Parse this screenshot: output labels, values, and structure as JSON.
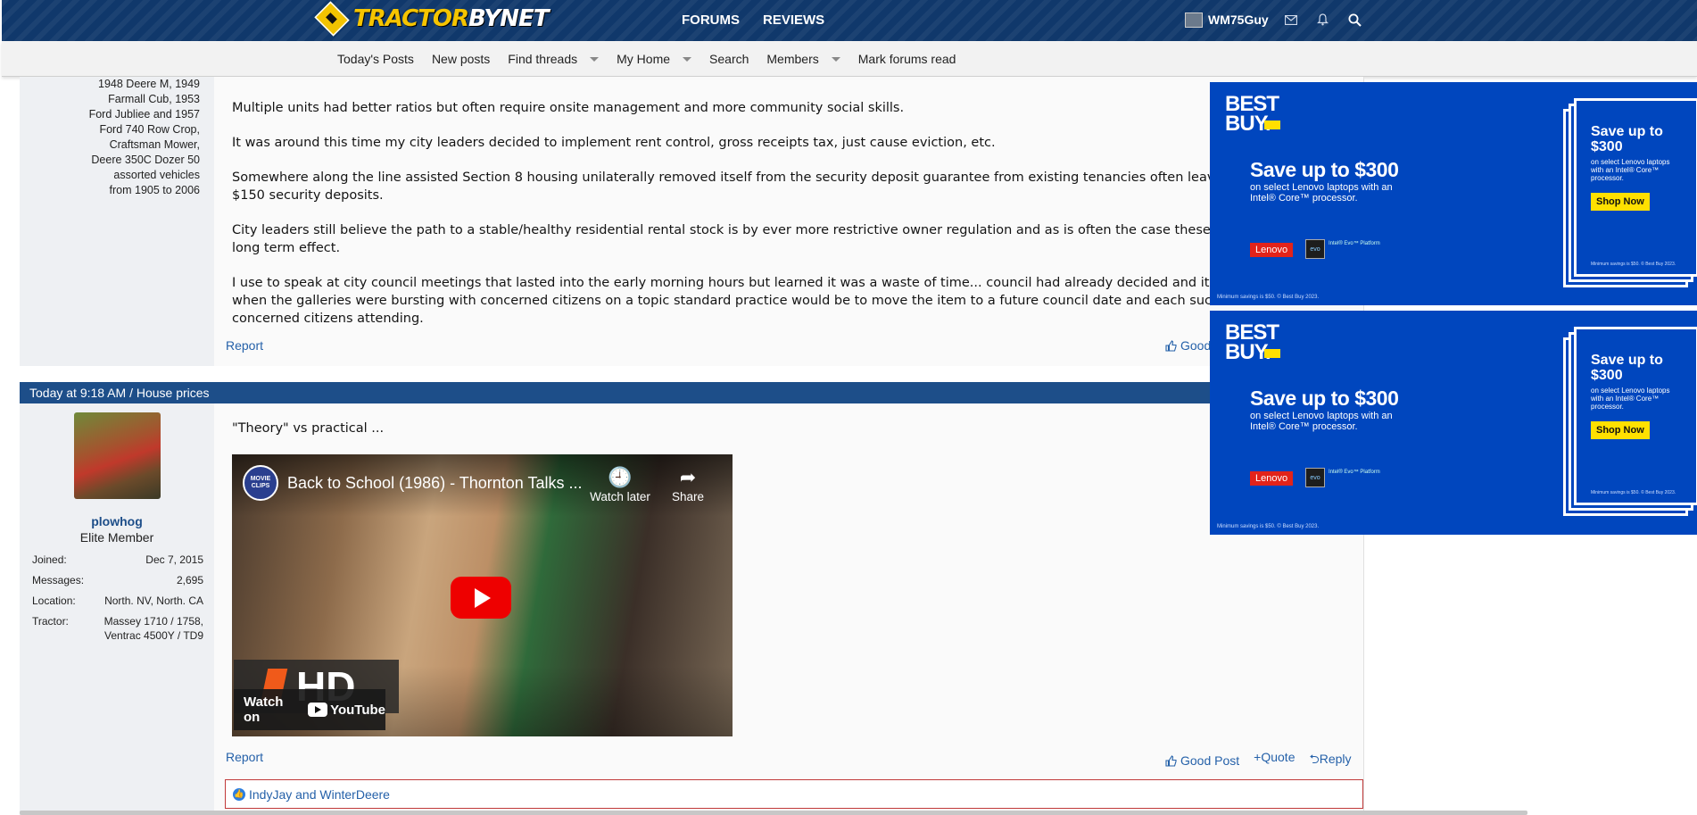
{
  "header": {
    "logo_text_a": "TRACTOR",
    "logo_text_b": "BYNET",
    "nav": [
      "FORUMS",
      "REVIEWS"
    ],
    "username": "WM75Guy"
  },
  "subnav": {
    "items": [
      "Today's Posts",
      "New posts",
      "Find threads",
      "My Home",
      "Search",
      "Members",
      "Mark forums read"
    ]
  },
  "post1": {
    "tractor_lines": [
      "1948 Deere M, 1949",
      "Farmall Cub, 1953",
      "Ford Jubliee and 1957",
      "Ford 740 Row Crop,",
      "Craftsman Mower,",
      "Deere 350C Dozer 50",
      "assorted vehicles",
      "from 1905 to 2006"
    ],
    "paragraphs": [
      "Multiple units had better ratios but often require onsite management and more community social skills.",
      "It was around this time my city leaders decided to implement rent control, gross receipts tax, just cause eviction, etc.",
      "Somewhere along the line assisted Section 8 housing unilaterally removed itself from the security deposit guarantee from existing tenancies often leaving c",
      "$150 security deposits.",
      "City leaders still believe the path to a stable/healthy residential rental stock is by ever more restrictive owner regulation and as is often the case these acti",
      "long term effect.",
      "I use to speak at city council meetings that lasted into the early morning hours but learned it was a waste of time... council had already decided and it was",
      "when the galleries were bursting with concerned citizens on a topic standard practice would be to move the item to a future council date and each such act",
      "concerned citizens attending."
    ],
    "report": "Report",
    "good_post": "Good"
  },
  "post2": {
    "header": "Today at 9:18 AM / House prices",
    "username": "plowhog",
    "title": "Elite Member",
    "stats": [
      {
        "label": "Joined:",
        "value": "Dec 7, 2015"
      },
      {
        "label": "Messages:",
        "value": "2,695"
      },
      {
        "label": "Location:",
        "value": "North. NV, North. CA"
      },
      {
        "label": "Tractor:",
        "value": "Massey 1710 / 1758,"
      },
      {
        "label": "",
        "value": "Ventrac 4500Y / TD9"
      }
    ],
    "body": "\"Theory\" vs practical ...",
    "video": {
      "channel": "MOVIE CLIPS",
      "title": "Back to School (1986) - Thornton Talks ...",
      "watch_later": "Watch later",
      "share": "Share",
      "hd": "HD",
      "watch_on": "Watch on",
      "youtube": "YouTube"
    },
    "report": "Report",
    "actions": [
      "Good Post",
      "Quote",
      "Reply"
    ],
    "reactions": "IndyJay and WinterDeere"
  },
  "ad": {
    "brand_a": "BEST",
    "brand_b": "BUY.",
    "headline": "Save up to $300",
    "sub": "on select Lenovo laptops with an Intel® Core™ processor.",
    "lenovo": "Lenovo",
    "evo": "evo",
    "intel_text": "Intel® Evo™ Platform",
    "minimum": "Minimum savings is $50. © Best Buy 2023.",
    "card_head": "Save up to $300",
    "card_sub": "on select Lenovo laptops with an Intel® Core™ processor.",
    "shop": "Shop Now",
    "card_min": "Minimum savings is $50. © Best Buy 2023."
  }
}
